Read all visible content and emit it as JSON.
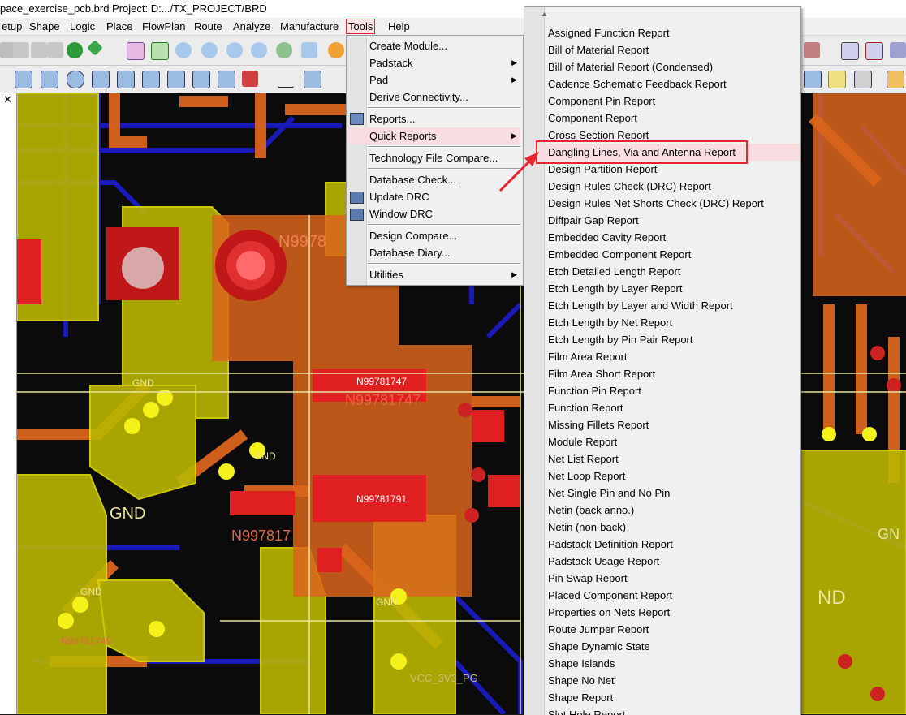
{
  "title_bar": {
    "text": "pace_exercise_pcb.brd  Project: D:.../TX_PROJECT/BRD"
  },
  "menubar": {
    "items": [
      "etup",
      "Shape",
      "Logic",
      "Place",
      "FlowPlan",
      "Route",
      "Analyze",
      "Manufacture",
      "Tools",
      "Help"
    ],
    "active": "Tools"
  },
  "tools_menu": {
    "items": [
      {
        "label": "Create Module...",
        "submenu": false
      },
      {
        "label": "Padstack",
        "submenu": true
      },
      {
        "label": "Pad",
        "submenu": true
      },
      {
        "label": "Derive Connectivity...",
        "submenu": false
      },
      {
        "label": "Reports...",
        "submenu": false
      },
      {
        "label": "Quick Reports",
        "submenu": true
      },
      {
        "label": "Technology File Compare...",
        "submenu": false
      },
      {
        "label": "Database Check...",
        "submenu": false
      },
      {
        "label": "Update DRC",
        "submenu": false
      },
      {
        "label": "Window DRC",
        "submenu": false
      },
      {
        "label": "Design Compare...",
        "submenu": false
      },
      {
        "label": "Database Diary...",
        "submenu": false
      },
      {
        "label": "Utilities",
        "submenu": true
      }
    ],
    "highlighted": "Quick Reports"
  },
  "quick_reports_menu": {
    "items": [
      "Assigned Function Report",
      "Bill of Material Report",
      "Bill of Material Report (Condensed)",
      "Cadence Schematic Feedback Report",
      "Component Pin Report",
      "Component Report",
      "Cross-Section Report",
      "Dangling Lines, Via and Antenna Report",
      "Design Partition Report",
      "Design Rules Check (DRC) Report",
      "Design Rules Net Shorts Check (DRC) Report",
      "Diffpair Gap Report",
      "Embedded Cavity Report",
      "Embedded Component Report",
      "Etch Detailed Length Report",
      "Etch Length by Layer Report",
      "Etch Length by Layer and Width Report",
      "Etch Length by Net Report",
      "Etch Length by Pin Pair Report",
      "Film Area Report",
      "Film Area Short Report",
      "Function Pin Report",
      "Function Report",
      "Missing Fillets Report",
      "Module Report",
      "Net List Report",
      "Net Loop Report",
      "Net Single Pin and No Pin",
      "Netin (back anno.)",
      "Netin (non-back)",
      "Padstack Definition Report",
      "Padstack Usage Report",
      "Pin Swap Report",
      "Placed Component Report",
      "Properties on Nets Report",
      "Route Jumper Report",
      "Shape Dynamic State",
      "Shape Islands",
      "Shape No Net",
      "Shape Report",
      "Slot Hole Report"
    ],
    "highlighted": "Dangling Lines, Via and Antenna Report"
  },
  "canvas_labels": {
    "n1": "N9978",
    "n2": "N99781747",
    "n3": "N99781747",
    "n4": "N99781791",
    "n5": "N997817",
    "n6": "N99781749",
    "gnd1": "GND",
    "gnd2": "GND",
    "gnd3": "GND",
    "gnd4": "GND",
    "gnd5": "GND",
    "gnd6": "ND",
    "gnd7": "GN",
    "vcc": "VCC_3V3_PG"
  },
  "colors": {
    "accent_red": "#e5262f",
    "highlight": "#f7dce0",
    "board_yellow": "#b9b600",
    "board_orange": "#d9651c",
    "trace_blue": "#1a1ab8"
  }
}
